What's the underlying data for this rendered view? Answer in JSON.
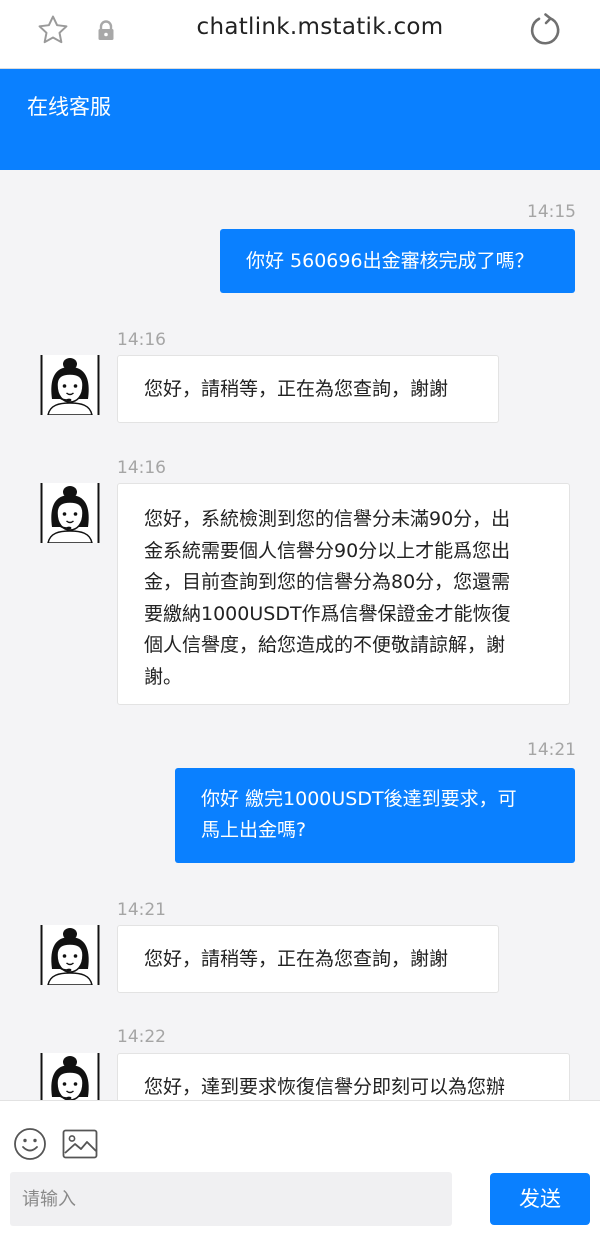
{
  "browser": {
    "url": "chatlink.mstatik.com",
    "icons": [
      "star-icon",
      "lock-icon",
      "reload-icon"
    ]
  },
  "header": {
    "title": "在线客服"
  },
  "messages": [
    {
      "sender": "user",
      "time": "14:15",
      "text": "你好 560696出金審核完成了嗎？"
    },
    {
      "sender": "agent",
      "time": "14:16",
      "text": "您好，請稍等，正在為您查詢，謝謝"
    },
    {
      "sender": "agent",
      "time": "14:16",
      "lines": [
        "您好，系統檢測到您的信譽分未滿90分，出",
        "金系統需要個人信譽分90分以上才能爲您出",
        "金，目前查詢到您的信譽分為80分，您還需",
        "要繳納1000USDT作爲信譽保證金才能恢復",
        "個人信譽度，給您造成的不便敬請諒解，謝",
        "謝。"
      ]
    },
    {
      "sender": "user",
      "time": "14:21",
      "lines": [
        "你好 繳完1000USDT後達到要求，可",
        "馬上出金嗎?"
      ]
    },
    {
      "sender": "agent",
      "time": "14:21",
      "text": "您好，請稍等，正在為您查詢，謝謝"
    },
    {
      "sender": "agent",
      "time": "14:22",
      "text": "您好，達到要求恢復信譽分即刻可以為您辦"
    }
  ],
  "composer": {
    "placeholder": "请输入",
    "send_label": "发送",
    "icons": [
      "emoji-icon",
      "image-icon"
    ]
  },
  "colors": {
    "accent": "#0a80ff",
    "background": "#f4f4f6",
    "time": "#a5a5a5"
  }
}
